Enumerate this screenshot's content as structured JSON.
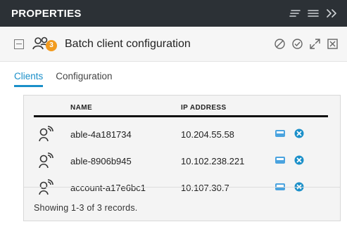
{
  "header": {
    "title": "PROPERTIES",
    "icons": [
      "sort-icon",
      "menu-icon",
      "expand-panel-icon"
    ]
  },
  "titlebar": {
    "title": "Batch client configuration",
    "badge_count": "3",
    "actions": [
      "cancel-icon",
      "confirm-icon",
      "maximize-icon",
      "close-icon"
    ]
  },
  "tabs": [
    {
      "label": "Clients",
      "active": true
    },
    {
      "label": "Configuration",
      "active": false
    }
  ],
  "table": {
    "columns": [
      "NAME",
      "IP ADDRESS"
    ],
    "rows": [
      {
        "name": "able-4a181734",
        "ip": "10.204.55.58"
      },
      {
        "name": "able-8906b945",
        "ip": "10.102.238.221"
      },
      {
        "name": "account-a17e6bc1",
        "ip": "10.107.30.7"
      }
    ],
    "footer": "Showing 1-3 of 3 records."
  },
  "colors": {
    "header_bg": "#2c3136",
    "accent": "#1a8fc9",
    "badge": "#f29b1f"
  }
}
